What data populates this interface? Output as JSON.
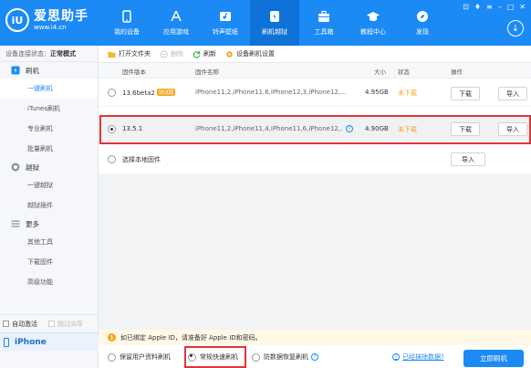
{
  "header": {
    "logo_mark": "iU",
    "logo_name": "爱思助手",
    "logo_url": "www.i4.cn",
    "nav": [
      {
        "label": "我的设备",
        "icon": "phone-icon"
      },
      {
        "label": "应用游戏",
        "icon": "app-store-icon"
      },
      {
        "label": "铃声壁纸",
        "icon": "music-icon"
      },
      {
        "label": "刷机越狱",
        "icon": "flash-icon",
        "active": true
      },
      {
        "label": "工具箱",
        "icon": "toolbox-icon"
      },
      {
        "label": "教程中心",
        "icon": "graduation-cap-icon"
      },
      {
        "label": "发现",
        "icon": "compass-icon"
      }
    ],
    "window_controls": [
      "⊡",
      "♦",
      "≡",
      "–",
      "□",
      "✕"
    ],
    "download_icon": "↓"
  },
  "sidebar": {
    "status_label": "设备连接状态：",
    "status_value": "正常模式",
    "flash_section": "刷机",
    "flash_items": [
      "一键刷机",
      "iTunes刷机",
      "专业刷机",
      "批量刷机"
    ],
    "jailbreak_section": "越狱",
    "jailbreak_items": [
      "一键越狱",
      "越狱插件"
    ],
    "more_section": "更多",
    "more_items": [
      "其他工具",
      "下载固件",
      "高级功能"
    ],
    "auto_activate": "自动激活",
    "skip_guide": "跳过向导",
    "device": "iPhone"
  },
  "toolbar": {
    "open_folder": "打开文件夹",
    "delete": "删除",
    "refresh": "刷新",
    "settings": "设备刷机设置"
  },
  "table": {
    "headers": {
      "version": "固件版本",
      "name": "固件名称",
      "size": "大小",
      "status": "状态",
      "action": "操作"
    },
    "rows": [
      {
        "version": "13.6beta2",
        "badge": "测试版",
        "name": "iPhone11,2,iPhone11,6,iPhone12,3,iPhone12,...",
        "size": "4.95GB",
        "status": "未下载",
        "download": "下载",
        "import": "导入"
      },
      {
        "version": "13.5.1",
        "name": "iPhone11,2,iPhone11,4,iPhone11,6,iPhone12,...",
        "size": "4.90GB",
        "status": "未下载",
        "download": "下载",
        "import": "导入"
      }
    ],
    "local": {
      "label": "选择本地固件",
      "import": "导入"
    }
  },
  "notice": "如已绑定 Apple ID，请准备好 Apple ID和密码。",
  "bottom": {
    "modes": [
      "保留用户资料刷机",
      "常规快速刷机",
      "防数据恢复刷机"
    ],
    "link": "已经抹除数据?",
    "primary": "立即刷机"
  },
  "colors": {
    "brand": "#1b8af5",
    "highlight": "#e0353a",
    "warning": "#f5a623"
  }
}
